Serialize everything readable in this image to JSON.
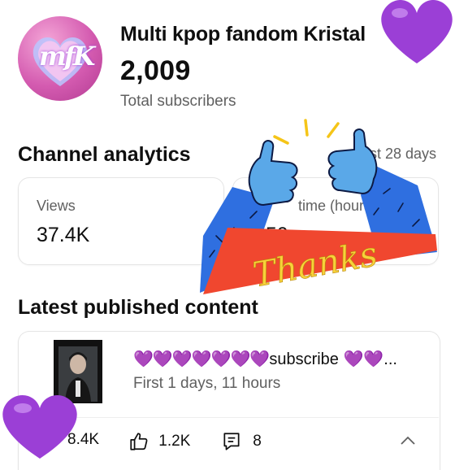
{
  "channel": {
    "avatar_monogram": "mfK",
    "name": "Multi kpop fandom Kristal",
    "subscriber_count": "2,009",
    "subscriber_label": "Total subscribers"
  },
  "analytics": {
    "title": "Channel analytics",
    "period": "st 28 days",
    "cards": [
      {
        "label": "Views",
        "value": "37.4K"
      },
      {
        "label": "time (hours)",
        "value": "150"
      }
    ]
  },
  "latest": {
    "title": "Latest published content",
    "video": {
      "title_hearts": "💜💜💜💜💜💜💜",
      "title_text": "subscribe 💜💜...",
      "age": "First 1 days, 11 hours",
      "views": "8.4K",
      "likes": "1.2K",
      "comments": "8"
    }
  },
  "stickers": {
    "thanks_text": "Thanks",
    "heart_color": "#9b3fd6",
    "thanks_banner_color": "#f0472f",
    "sleeve_color": "#2f6fe0",
    "hand_color": "#5aa8e8",
    "spark_color": "#f5c518"
  }
}
